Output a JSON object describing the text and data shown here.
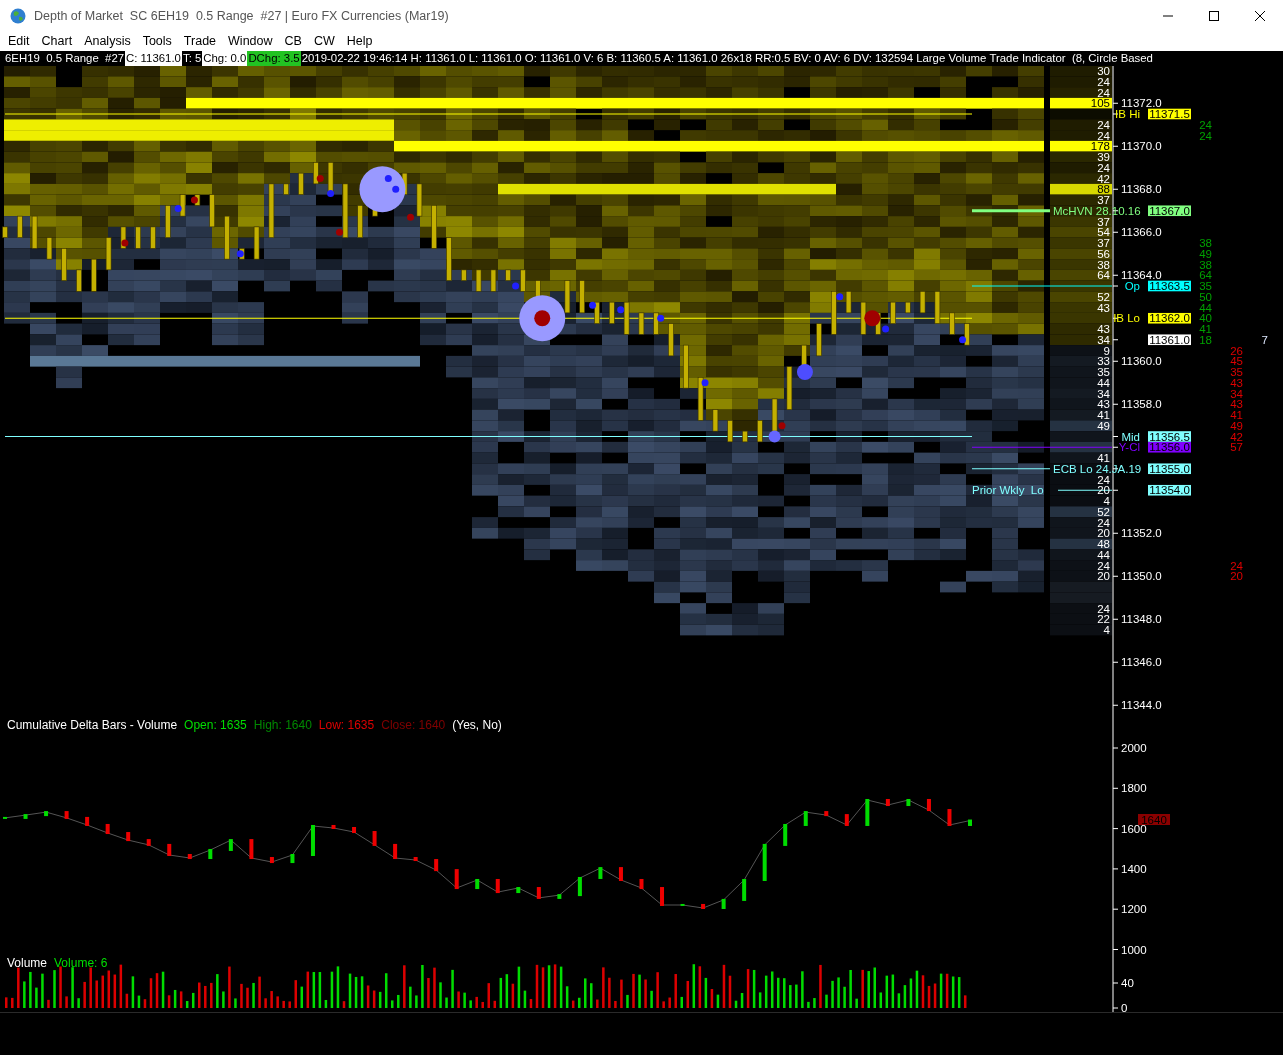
{
  "window": {
    "title": "Depth of Market  SC 6EH19  0.5 Range  #27 | Euro FX Currencies (Mar19)"
  },
  "menu": [
    "Edit",
    "Chart",
    "Analysis",
    "Tools",
    "Trade",
    "Window",
    "CB",
    "CW",
    "Help"
  ],
  "header_segments": [
    {
      "text": "6EH19  0.5 Range  #27"
    },
    {
      "text": "C: 11361.0"
    },
    {
      "text": "T: 5"
    },
    {
      "text": "Chg: 0.0"
    },
    {
      "text": "DChg: 3.5"
    },
    {
      "text": "2019-02-22 19:46:14 H: 11361.0 L: 11361.0 O: 11361.0 V: 6 B: 11360.5 A: 11361.0 26x18 RR:0.5 BV: 0 AV: 6 DV: 132594 Large Volume Trade Indicator  (8, Circle Based"
    }
  ],
  "price_ladder": {
    "rows": [
      {
        "volume": "30",
        "color": "#1f1c00"
      },
      {
        "volume": "24",
        "color": "#1f1c00"
      },
      {
        "volume": "24",
        "color": "#262200"
      },
      {
        "volume": "105",
        "price": "11372.0",
        "color": "#ffff00"
      },
      {
        "marker": {
          "text": "11371.5",
          "color": "#ffff00"
        },
        "label": {
          "text": "IB Hi",
          "kind": "range"
        },
        "color": "#0c0c00"
      },
      {
        "volume": "24",
        "ask": "24",
        "color": "#1f1c00"
      },
      {
        "volume": "24",
        "ask": "24",
        "color": "#1f1c00"
      },
      {
        "volume": "178",
        "price": "11370.0",
        "color": "#ffff00"
      },
      {
        "volume": "39",
        "color": "#2b2800"
      },
      {
        "volume": "24",
        "color": "#1f1c00"
      },
      {
        "volume": "42",
        "color": "#2b2800"
      },
      {
        "volume": "88",
        "price": "11368.0",
        "color": "#d8d800"
      },
      {
        "volume": "37",
        "color": "#2b2800"
      },
      {
        "marker": {
          "text": "11367.0",
          "color": "#80ff80"
        },
        "label": {
          "text": "McHVN 28.10.16",
          "kind": "note"
        },
        "color": "#2b2800"
      },
      {
        "volume": "37",
        "color": "#3a3600"
      },
      {
        "volume": "54",
        "price": "11366.0",
        "color": "#4a4500"
      },
      {
        "volume": "37",
        "ask": "38",
        "color": "#3a3600"
      },
      {
        "volume": "56",
        "ask": "49",
        "color": "#4a4500"
      },
      {
        "volume": "38",
        "ask": "38",
        "color": "#3a3600"
      },
      {
        "volume": "64",
        "ask": "64",
        "price": "11364.0",
        "color": "#4a4500"
      },
      {
        "ask": "35",
        "marker": {
          "text": "11363.5",
          "color": "#00ffff"
        },
        "label": {
          "text": "Op",
          "kind": "open"
        },
        "color": "#3a3600"
      },
      {
        "volume": "52",
        "ask": "50",
        "color": "#4a4500"
      },
      {
        "volume": "43",
        "ask": "44",
        "color": "#3a3600"
      },
      {
        "ask": "40",
        "marker": {
          "text": "11362.0",
          "color": "#ffff00"
        },
        "label": {
          "text": "IB Lo",
          "kind": "range"
        },
        "color": "#3a3600"
      },
      {
        "volume": "43",
        "ask": "41",
        "color": "#2e2a00"
      },
      {
        "volume": "34",
        "ask": "18",
        "trades": "7",
        "marker": {
          "text": "11361.0",
          "color": "#ffffff"
        },
        "color": "#2e2a00"
      },
      {
        "volume": "9",
        "bid": "26",
        "color": "#0d1117"
      },
      {
        "volume": "33",
        "bid": "45",
        "price": "11360.0",
        "color": "#141a22"
      },
      {
        "volume": "35",
        "bid": "35",
        "color": "#10151c"
      },
      {
        "volume": "44",
        "bid": "43",
        "color": "#10151c"
      },
      {
        "volume": "34",
        "bid": "34",
        "color": "#141a22"
      },
      {
        "volume": "43",
        "bid": "43",
        "price": "11358.0",
        "color": "#10151c"
      },
      {
        "volume": "41",
        "bid": "41",
        "color": "#141a22"
      },
      {
        "volume": "49",
        "bid": "49",
        "color": "#253242"
      },
      {
        "bid": "42",
        "marker": {
          "text": "11356.5",
          "color": "#80ffff"
        },
        "label": {
          "text": "Mid",
          "kind": "range"
        },
        "color": "#10151c"
      },
      {
        "bid": "57",
        "marker": {
          "text": "11356.0",
          "color": "#8000ff"
        },
        "label": {
          "text": "Y-Cl",
          "kind": "open"
        },
        "color": "#253242"
      },
      {
        "volume": "41",
        "color": "#10151c"
      },
      {
        "marker": {
          "text": "11355.0",
          "color": "#80ffff"
        },
        "label": {
          "text": "ECB Lo 24.JA.19",
          "kind": "note"
        },
        "color": "#0a0d12"
      },
      {
        "volume": "24",
        "color": "#0a0d12"
      },
      {
        "volume": "20",
        "marker": {
          "text": "11354.0",
          "color": "#80ffff"
        },
        "label": {
          "text": "Prior Wkly  Lo",
          "kind": "weekly"
        },
        "color": "#0a0d12"
      },
      {
        "volume": "4",
        "color": "#0a0d12"
      },
      {
        "volume": "52",
        "color": "#253242"
      },
      {
        "volume": "24",
        "color": "#10151c"
      },
      {
        "volume": "20",
        "price": "11352.0",
        "color": "#10151c"
      },
      {
        "volume": "48",
        "color": "#253242"
      },
      {
        "volume": "44",
        "color": "#10151c"
      },
      {
        "volume": "24",
        "bid": "24",
        "color": "#0d1117"
      },
      {
        "volume": "20",
        "bid": "20",
        "price": "11350.0",
        "color": "#0d1117"
      },
      {
        "color": "#161b22"
      },
      {
        "color": "#161b22"
      },
      {
        "volume": "24",
        "color": "#0c0f14"
      },
      {
        "volume": "22",
        "price": "11348.0",
        "color": "#0c0f14"
      },
      {
        "volume": "4",
        "color": "#0c0f14"
      }
    ],
    "lower_axis_labels": [
      "11346.0",
      "11344.0"
    ]
  },
  "delta_panel": {
    "title_parts": [
      {
        "text": "Cumulative Delta Bars - Volume",
        "color": "#ffffff"
      },
      {
        "text": "Open: 1635",
        "color": "#00dd00"
      },
      {
        "text": "High: 1640",
        "color": "#008800"
      },
      {
        "text": "Low: 1635",
        "color": "#dd0000"
      },
      {
        "text": "Close: 1640",
        "color": "#800000"
      },
      {
        "text": "(Yes, No)",
        "color": "#ffffff"
      }
    ],
    "axis_labels": [
      "2000",
      "1800",
      "1600",
      "1400",
      "1200",
      "1000"
    ],
    "value_marker": "1640"
  },
  "volume_panel": {
    "title_parts": [
      {
        "text": "Volume",
        "color": "#ffffff"
      },
      {
        "text": "Volume: 6",
        "color": "#00dd00"
      }
    ],
    "axis_labels": [
      "40",
      "0"
    ]
  }
}
